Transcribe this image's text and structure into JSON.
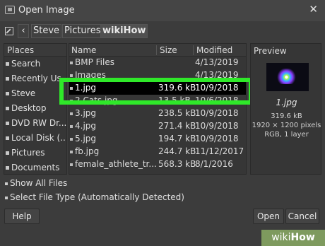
{
  "window": {
    "title": "Open Image",
    "close": "✕"
  },
  "path": {
    "back": "‹",
    "crumbs": [
      "Steve",
      "Pictures",
      "wikiHow"
    ]
  },
  "places": {
    "header": "Places",
    "items": [
      "Search",
      "Recently Us...",
      "Steve",
      "Desktop",
      "DVD RW Dr...",
      "Local Disk (...",
      "Pictures",
      "Documents",
      "+ -"
    ]
  },
  "files": {
    "headers": {
      "name": "Name",
      "size": "Size",
      "modified": "Modified"
    },
    "rows": [
      {
        "name": "BMP Files",
        "size": "",
        "date": "4/13/2019"
      },
      {
        "name": "Images",
        "size": "",
        "date": "4/13/2019"
      },
      {
        "name": "1.jpg",
        "size": "319.6 kB",
        "date": "10/9/2018"
      },
      {
        "name": "2 Cats.jpg",
        "size": "13.5 kB",
        "date": "10/6/2018"
      },
      {
        "name": "3.jpg",
        "size": "238.5 kB",
        "date": "10/9/2018"
      },
      {
        "name": "4.jpg",
        "size": "271.4 kB",
        "date": "10/9/2018"
      },
      {
        "name": "5.jpg",
        "size": "194.7 kB",
        "date": "10/9/2018"
      },
      {
        "name": "fb.jpg",
        "size": "244.7 kB",
        "date": "11/12/2017"
      },
      {
        "name": "female_athlete_tr...",
        "size": "568.3 kB",
        "date": "8/1/2016"
      }
    ]
  },
  "preview": {
    "title": "Preview",
    "name": "1.jpg",
    "size": "319.6 kB",
    "dimensions": "1920 × 1200 pixels",
    "mode": "RGB, 1 layer"
  },
  "options": {
    "show_all": "Show All Files",
    "file_type": "Select File Type (Automatically Detected)"
  },
  "buttons": {
    "help": "Help",
    "open": "Open",
    "cancel": "Cancel"
  },
  "watermark": {
    "prefix": "wiki",
    "suffix": "How"
  },
  "colors": {
    "highlight": "#2fe829",
    "selected_row": "#000000"
  }
}
